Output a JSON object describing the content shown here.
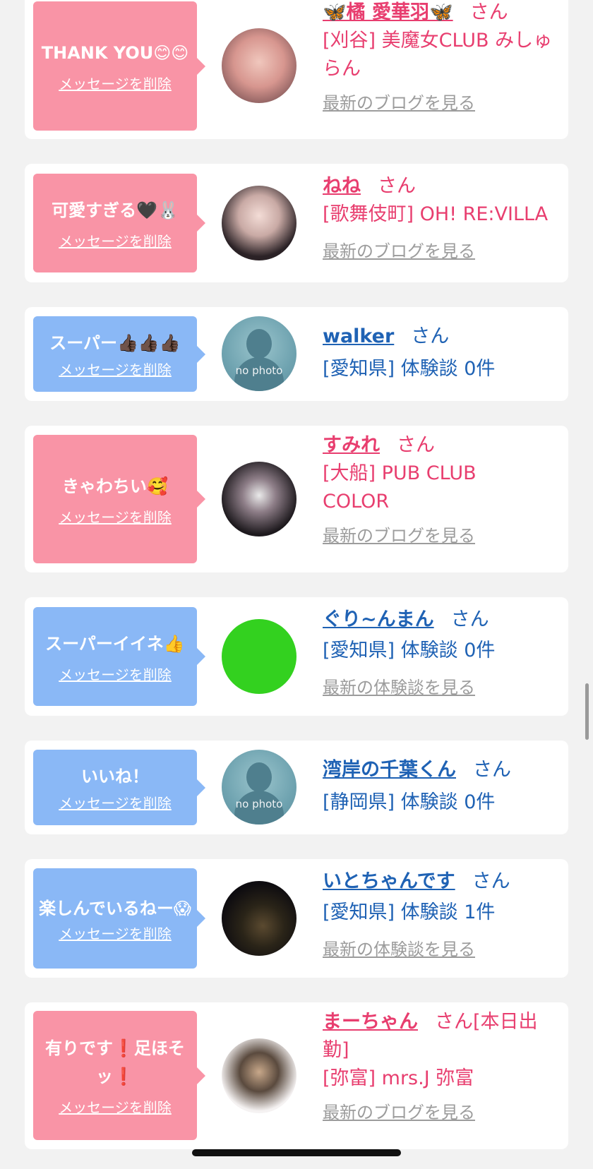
{
  "delete_label": "メッセージを削除",
  "colors": {
    "pink": "#f994a6",
    "blue": "#8ab8f6",
    "name_pink": "#e83e6f",
    "name_blue": "#1f62b4"
  },
  "items": [
    {
      "message": "THANK YOU😊😊",
      "name": "🦋橘 愛華羽🦋",
      "suffix": "さん",
      "shop": "[刈谷] 美魔女CLUB みしゅらん",
      "more": "最新のブログを見る"
    },
    {
      "message": "可愛すぎる🖤🐰",
      "name": "ねね",
      "suffix": "さん",
      "shop": "[歌舞伎町] OH! RE:VILLA",
      "more": "最新のブログを見る"
    },
    {
      "message": "スーパー👍🏿👍🏿👍🏿",
      "name": "walker",
      "suffix": "さん",
      "shop": "[愛知県] 体験談 0件",
      "avatar_label": "no photo"
    },
    {
      "message": "きゃわちい🥰",
      "name": "すみれ",
      "suffix": "さん",
      "shop": "[大船] PUB CLUB COLOR",
      "more": "最新のブログを見る"
    },
    {
      "message": "スーパーイイネ👍",
      "name": "ぐり~んまん",
      "suffix": "さん",
      "shop": "[愛知県] 体験談 0件",
      "more": "最新の体験談を見る"
    },
    {
      "message": "いいね！",
      "name": "湾岸の千葉くん",
      "suffix": "さん",
      "shop": "[静岡県] 体験談 0件",
      "avatar_label": "no photo"
    },
    {
      "message": "楽しんでいるねー😱",
      "name": "いとちゃんです",
      "suffix": "さん",
      "shop": "[愛知県] 体験談 1件",
      "more": "最新の体験談を見る"
    },
    {
      "message": "有りです❗️足ほそッ❗️",
      "name": "まーちゃん",
      "suffix": "さん[本日出勤]",
      "shop": "[弥富] mrs.J 弥富",
      "more": "最新のブログを見る"
    }
  ]
}
